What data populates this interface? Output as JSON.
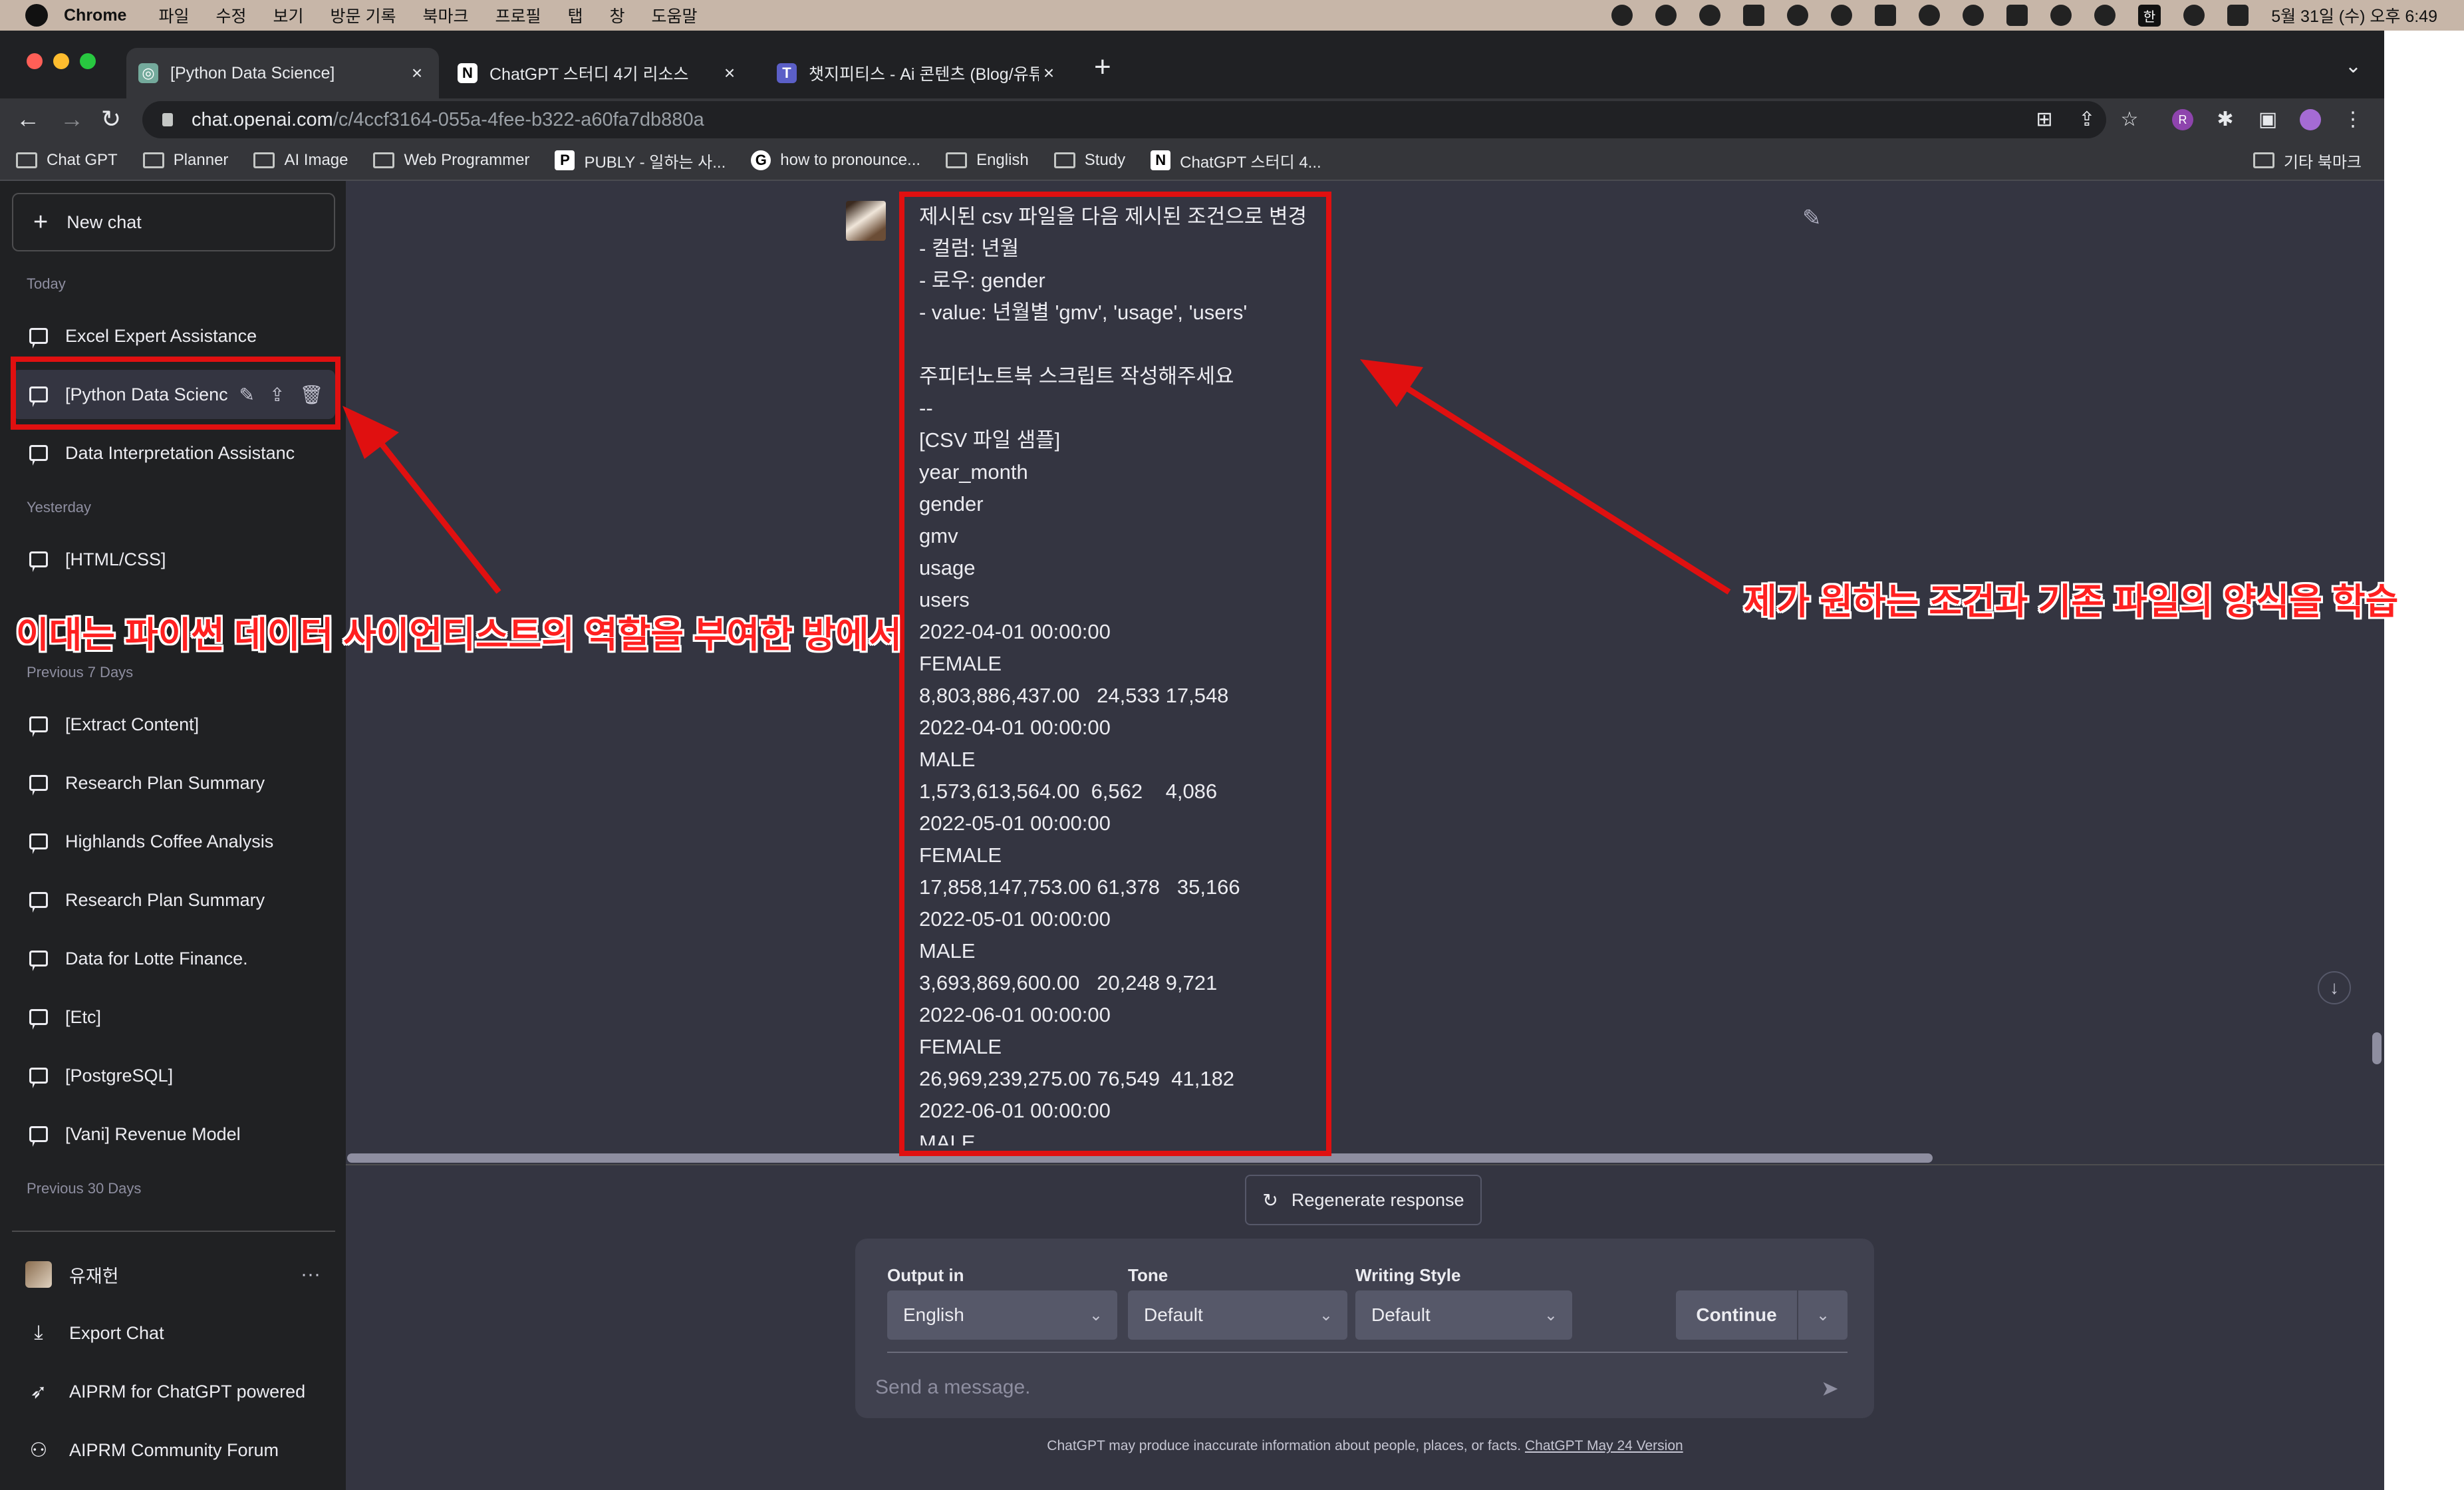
{
  "menubar": {
    "app_name": "Chrome",
    "menus": [
      "파일",
      "수정",
      "보기",
      "방문 기록",
      "북마크",
      "프로필",
      "탭",
      "창",
      "도움말"
    ],
    "input_source": "한",
    "clock": "5월 31일 (수) 오후 6:49"
  },
  "tabs": [
    {
      "title": "[Python Data Science]",
      "favicon": "chatgpt-icon"
    },
    {
      "title": "ChatGPT 스터디 4기 리소스",
      "favicon": "notion-icon"
    },
    {
      "title": "챗지피티스 - Ai 콘텐츠 (Blog/유튜",
      "favicon": "teams-icon"
    }
  ],
  "omnibox": {
    "host": "chat.openai.com",
    "path": "/c/4ccf3164-055a-4fee-b322-a60fa7db880a"
  },
  "bookmarks": [
    {
      "label": "Chat GPT",
      "icon": "folder-icon"
    },
    {
      "label": "Planner",
      "icon": "folder-icon"
    },
    {
      "label": "AI Image",
      "icon": "folder-icon"
    },
    {
      "label": "Web Programmer",
      "icon": "folder-icon"
    },
    {
      "label": "PUBLY - 일하는 사...",
      "icon": "publy-icon"
    },
    {
      "label": "how to pronounce...",
      "icon": "google-icon"
    },
    {
      "label": "English",
      "icon": "folder-icon"
    },
    {
      "label": "Study",
      "icon": "folder-icon"
    },
    {
      "label": "ChatGPT 스터디 4...",
      "icon": "notion-icon"
    }
  ],
  "other_bookmarks": "기타 북마크",
  "sidebar": {
    "new_chat": "New chat",
    "headings": {
      "today": "Today",
      "yesterday": "Yesterday",
      "prev7": "Previous 7 Days",
      "prev30": "Previous 30 Days"
    },
    "today": [
      "Excel Expert Assistance",
      "[Python Data Scienc",
      "Data Interpretation Assistanc"
    ],
    "yesterday": [
      "[HTML/CSS]"
    ],
    "prev7": [
      "[Extract Content]",
      "Research Plan Summary",
      "Highlands Coffee Analysis",
      "Research Plan Summary",
      "Data for Lotte Finance.",
      "[Etc]",
      "[PostgreSQL]",
      "[Vani] Revenue Model"
    ],
    "footer": {
      "user": "유재헌",
      "export": "Export Chat",
      "aiprm": "AIPRM for ChatGPT powered",
      "forum": "AIPRM Community Forum"
    }
  },
  "message": {
    "text": "제시된 csv 파일을 다음 제시된 조건으로 변경\n- 컬럼: 년월\n- 로우: gender\n- value: 년월별 'gmv', 'usage', 'users'\n\n주피터노트북 스크립트 작성해주세요\n--\n[CSV 파일 샘플]\nyear_month\ngender\ngmv\nusage\nusers\n2022-04-01 00:00:00\nFEMALE\n8,803,886,437.00   24,533 17,548\n2022-04-01 00:00:00\nMALE\n1,573,613,564.00  6,562    4,086\n2022-05-01 00:00:00\nFEMALE\n17,858,147,753.00 61,378   35,166\n2022-05-01 00:00:00\nMALE\n3,693,869,600.00   20,248 9,721\n2022-06-01 00:00:00\nFEMALE\n26,969,239,275.00 76,549  41,182\n2022-06-01 00:00:00\nMALE"
  },
  "regenerate": "Regenerate response",
  "composer": {
    "output_label": "Output in",
    "output_value": "English",
    "tone_label": "Tone",
    "tone_value": "Default",
    "style_label": "Writing Style",
    "style_value": "Default",
    "continue": "Continue",
    "placeholder": "Send a message."
  },
  "disclaimer": {
    "text": "ChatGPT may produce inaccurate information about people, places, or facts. ",
    "link": "ChatGPT May 24 Version"
  },
  "annotations": {
    "left": "이대는 파이썬 데이터 사이언티스트의 역할을 부여한 방에서",
    "right": "제가 원하는 조건과 기존 파일의 양식을 학습",
    "color": "#e01010"
  }
}
